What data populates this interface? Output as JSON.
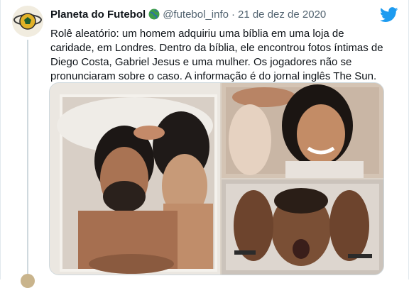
{
  "tweet": {
    "author_name": "Planeta do Futebol",
    "verified_icon": "globe-icon",
    "handle": "@futebol_info",
    "separator": "·",
    "date": "21 de dez de 2020",
    "text": "Rolê aleatório: um homem adquiriu uma bíblia em uma loja de caridade, em Londres. Dentro da bíblia, ele encontrou fotos íntimas de Diego Costa, Gabriel Jesus e uma mulher. Os jogadores não se pronunciaram sobre o caso. A informação é do jornal inglês The Sun.",
    "logo_icon": "twitter-bird-icon"
  },
  "media": {
    "photos": [
      "photo-man-woman-bed",
      "photo-woman-smiling",
      "photo-man-hands-on-head"
    ]
  },
  "colors": {
    "brand": "#1d9bf0",
    "text": "#0f1419",
    "secondary": "#536471",
    "thread_line": "#cfd9de"
  }
}
